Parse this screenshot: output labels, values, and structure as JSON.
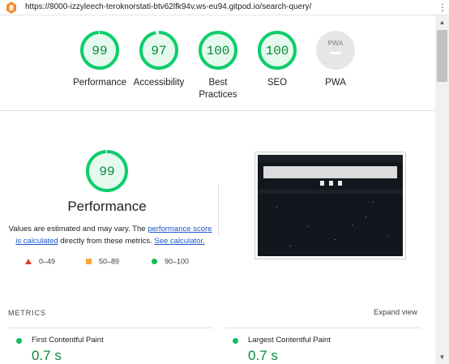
{
  "browser": {
    "url": "https://8000-izzyleech-teroknorstati-btv62lfk94v.ws-eu94.gitpod.io/search-query/"
  },
  "colors": {
    "pass": "#0cce6b",
    "average": "#ffa400",
    "fail": "#ff4e42",
    "link": "#1a56c8"
  },
  "categories": [
    {
      "id": "performance",
      "label": "Performance",
      "score": "99",
      "fraction": 0.99
    },
    {
      "id": "accessibility",
      "label": "Accessibility",
      "score": "97",
      "fraction": 0.97
    },
    {
      "id": "best-practices",
      "label": "Best Practices",
      "score": "100",
      "fraction": 1.0
    },
    {
      "id": "seo",
      "label": "SEO",
      "score": "100",
      "fraction": 1.0
    },
    {
      "id": "pwa",
      "label": "PWA",
      "badge": "PWA"
    }
  ],
  "performance": {
    "score": "99",
    "fraction": 0.99,
    "title": "Performance",
    "description_part1": "Values are estimated and may vary. The",
    "link1": "performance score is calculated",
    "description_part2": "directly from these metrics.",
    "link2": "See calculator.",
    "legend": [
      {
        "shape": "triangle",
        "range": "0–49"
      },
      {
        "shape": "square",
        "range": "50–89"
      },
      {
        "shape": "circle",
        "range": "90–100"
      }
    ]
  },
  "metrics": {
    "title": "METRICS",
    "expand_label": "Expand view",
    "items": [
      {
        "name": "First Contentful Paint",
        "value": "0.7 s"
      },
      {
        "name": "Largest Contentful Paint",
        "value": "0.7 s"
      }
    ]
  }
}
